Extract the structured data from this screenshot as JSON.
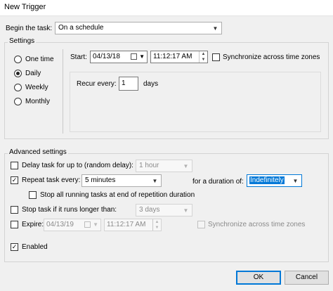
{
  "window": {
    "title": "New Trigger"
  },
  "begin": {
    "label": "Begin the task:",
    "value": "On a schedule"
  },
  "settings": {
    "title": "Settings",
    "options": [
      "One time",
      "Daily",
      "Weekly",
      "Monthly"
    ],
    "selected": "Daily",
    "start_label": "Start:",
    "start_date": "04/13/18",
    "start_time": "11:12:17 AM",
    "sync_label": "Synchronize across time zones",
    "recur_label": "Recur every:",
    "recur_value": "1",
    "recur_unit": "days"
  },
  "advanced": {
    "title": "Advanced settings",
    "delay_label": "Delay task for up to (random delay):",
    "delay_value": "1 hour",
    "repeat_label": "Repeat task every:",
    "repeat_value": "5 minutes",
    "duration_label": "for a duration of:",
    "duration_value": "Indefinitely",
    "stop_running_label": "Stop all running tasks at end of repetition duration",
    "stop_longer_label": "Stop task if it runs longer than:",
    "stop_longer_value": "3 days",
    "expire_label": "Expire:",
    "expire_date": "04/13/19",
    "expire_time": "11:12:17 AM",
    "expire_sync_label": "Synchronize across time zones",
    "enabled_label": "Enabled"
  },
  "buttons": {
    "ok": "OK",
    "cancel": "Cancel"
  },
  "icons": {
    "dropdown": "chevron-down-icon",
    "spin": "spinner-icon",
    "calendar": "calendar-dropdown-icon",
    "check": "checkmark-icon"
  },
  "colors": {
    "accent": "#0078d7"
  }
}
